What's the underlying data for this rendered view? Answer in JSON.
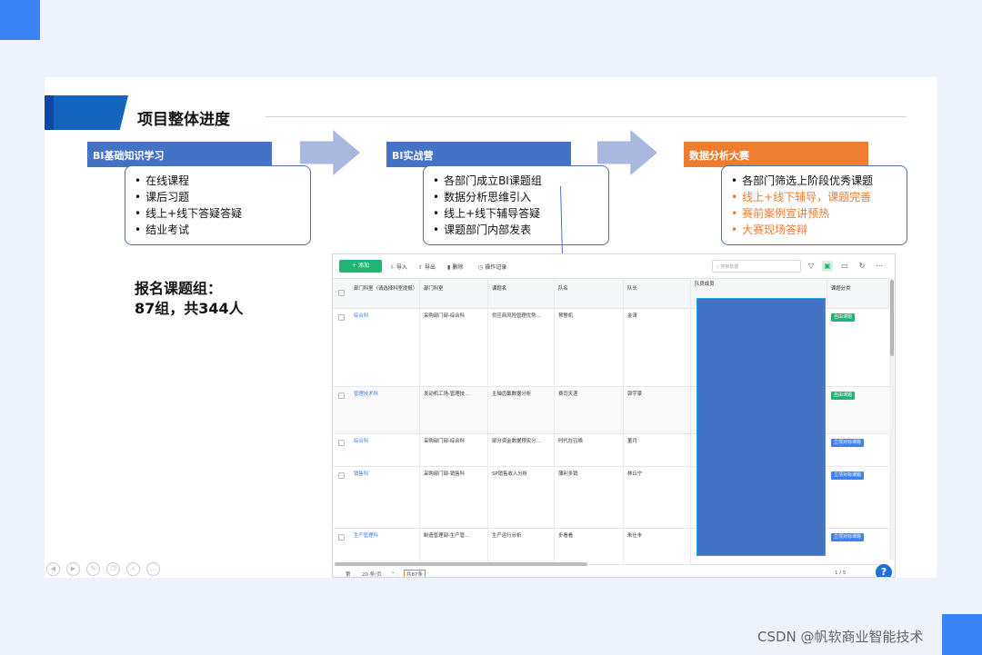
{
  "slide": {
    "title": "项目整体进度",
    "signup_line1": "报名课题组：",
    "signup_line2": "87组，共344人"
  },
  "phases": [
    {
      "header": "BI基础知识学习",
      "items": [
        "在线课程",
        "课后习题",
        "线上+线下答疑答疑",
        "结业考试"
      ]
    },
    {
      "header": "BI实战营",
      "items": [
        "各部门成立BI课题组",
        "数据分析思维引入",
        "线上+线下辅导答疑",
        "课题部门内部发表"
      ]
    },
    {
      "header": "数据分析大赛",
      "items": [
        "各部门筛选上阶段优秀课题",
        "线上+线下辅导，课题完善",
        "赛前案例宣讲预热",
        "大赛现场答辩"
      ]
    }
  ],
  "app": {
    "toolbar": {
      "add": "+ 添加",
      "import": "导入",
      "export": "导出",
      "delete": "删除",
      "log": "操作记录",
      "search_placeholder": "搜索数据"
    },
    "headers": [
      "部门科室（请选择科室提报）",
      "部门科室",
      "课题名",
      "队名",
      "队长",
      "队员成员",
      "课题分类"
    ],
    "rows": [
      {
        "dept": "综合科",
        "dept2": "采购部门部-综合科",
        "topic": "供应商风险管理优势…",
        "team": "预警机",
        "leader": "金涛",
        "tag": "自由课题",
        "tag_color": "green"
      },
      {
        "dept": "管理技术科",
        "dept2": "发动机工场-管理技…",
        "topic": "主轴齿截数据分析",
        "team": "费司天涯",
        "leader": "郭宇豪",
        "tag": "自由课题",
        "tag_color": "green"
      },
      {
        "dept": "综合科",
        "dept2": "采购部门部-综合科",
        "topic": "部分资金数据预实分…",
        "team": "时代在召唤",
        "leader": "董月",
        "tag": "立项对标课题",
        "tag_color": "blue"
      },
      {
        "dept": "销售科",
        "dept2": "采购部门部-销售科",
        "topic": "SP销售收入分析",
        "team": "薄利多销",
        "leader": "林丘宁",
        "tag": "立项对标课题",
        "tag_color": "blue"
      },
      {
        "dept": "生产管理科",
        "dept2": "制造管理部-生产管…",
        "topic": "生产运行分析",
        "team": "步看看",
        "leader": "朱仕丰",
        "tag": "立项对标课题",
        "tag_color": "blue"
      }
    ],
    "footer": {
      "prefix": "第",
      "page_size": "20 条/页",
      "total": "共87条",
      "pager": "1 / 5"
    },
    "help": "?"
  },
  "slide_controls": [
    "◀",
    "▶",
    "✎",
    "❐",
    "⌕",
    "…"
  ],
  "watermark": "CSDN @帆软商业智能技术",
  "colors": {
    "accent_blue": "#4472c4",
    "accent_orange": "#ed7d31",
    "green": "#21b573"
  }
}
